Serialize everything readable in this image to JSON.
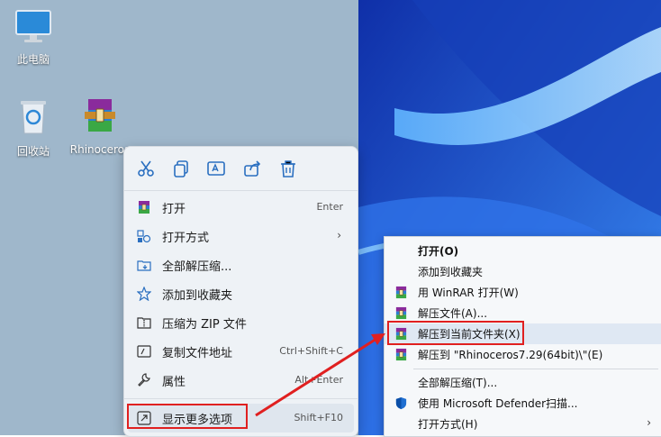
{
  "desktop": {
    "icons": [
      {
        "label": "此电脑",
        "icon": "monitor-icon"
      },
      {
        "label": "回收站",
        "icon": "recycle-bin-icon"
      },
      {
        "label": "Rhinoceros",
        "icon": "winrar-archive-icon"
      }
    ]
  },
  "context_menu": {
    "quick_actions": [
      {
        "name": "cut",
        "icon": "scissors-icon"
      },
      {
        "name": "copy",
        "icon": "copy-icon"
      },
      {
        "name": "rename",
        "icon": "rename-icon"
      },
      {
        "name": "share",
        "icon": "share-icon"
      },
      {
        "name": "delete",
        "icon": "trash-icon"
      }
    ],
    "items": [
      {
        "label": "打开",
        "shortcut": "Enter",
        "icon": "winrar-icon"
      },
      {
        "label": "打开方式",
        "shortcut": "",
        "icon": "open-with-icon",
        "submenu": "›"
      },
      {
        "label": "全部解压缩...",
        "shortcut": "",
        "icon": "extract-all-icon"
      },
      {
        "label": "添加到收藏夹",
        "shortcut": "",
        "icon": "star-icon"
      },
      {
        "label": "压缩为 ZIP 文件",
        "shortcut": "",
        "icon": "zip-folder-icon"
      },
      {
        "label": "复制文件地址",
        "shortcut": "Ctrl+Shift+C",
        "icon": "copy-path-icon"
      },
      {
        "label": "属性",
        "shortcut": "Alt+Enter",
        "icon": "wrench-icon"
      },
      {
        "label": "显示更多选项",
        "shortcut": "Shift+F10",
        "icon": "more-options-icon"
      }
    ]
  },
  "classic_menu": {
    "items": [
      {
        "label": "打开(O)",
        "bold": true,
        "icon": ""
      },
      {
        "label": "添加到收藏夹",
        "icon": ""
      },
      {
        "label": "用 WinRAR 打开(W)",
        "icon": "winrar-icon"
      },
      {
        "label": "解压文件(A)...",
        "icon": "winrar-icon"
      },
      {
        "label": "解压到当前文件夹(X)",
        "icon": "winrar-icon"
      },
      {
        "label": "解压到 \"Rhinoceros7.29(64bit)\\\"(E)",
        "icon": "winrar-icon"
      },
      {
        "label": "全部解压缩(T)...",
        "icon": ""
      },
      {
        "label": "使用 Microsoft Defender扫描...",
        "icon": "defender-shield-icon"
      },
      {
        "label": "打开方式(H)",
        "icon": "",
        "submenu": "›"
      }
    ]
  },
  "colors": {
    "highlight_box": "#e02020",
    "arrow": "#e02020",
    "wallpaper": "#1f5ad8"
  }
}
